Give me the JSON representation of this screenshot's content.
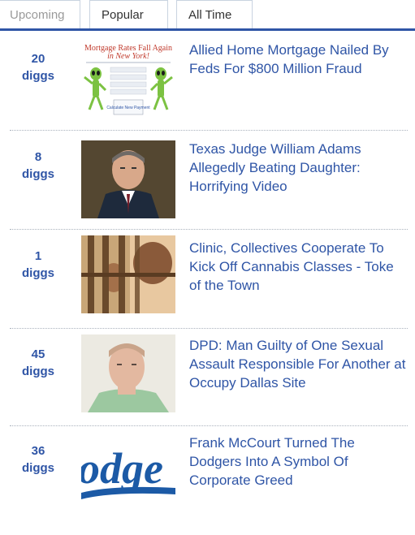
{
  "tabs": [
    {
      "label": "Upcoming"
    },
    {
      "label": "Popular"
    },
    {
      "label": "All Time"
    }
  ],
  "colors": {
    "link": "#2f55a6",
    "tab_rule": "#2f55a6",
    "inactive_tab_text": "#9a9a9a"
  },
  "stories": [
    {
      "count": "20",
      "unit": "diggs",
      "title": "Allied Home Mortgage Nailed By Feds For $800 Million Fraud",
      "thumb_text_1": "Mortgage Rates Fall Again",
      "thumb_text_2": "in New York!",
      "thumb_text_3": "Calculate New Payment",
      "thumb_icon": "alien-dancing-ad-icon"
    },
    {
      "count": "8",
      "unit": "diggs",
      "title": "Texas Judge William Adams Allegedly Beating Daughter: Horrifying Video",
      "thumb_icon": "man-portrait-icon"
    },
    {
      "count": "1",
      "unit": "diggs",
      "title": "Clinic, Collectives Cooperate To Kick Off Cannabis Classes - Toke of the Town",
      "thumb_icon": "jail-bars-icon"
    },
    {
      "count": "45",
      "unit": "diggs",
      "title": "DPD: Man Guilty of One Sexual Assault Responsible For Another at Occupy Dallas Site",
      "thumb_icon": "mugshot-icon"
    },
    {
      "count": "36",
      "unit": "diggs",
      "title": "Frank McCourt Turned The Dodgers Into A Symbol Of Corporate Greed",
      "thumb_text_1": "odge",
      "thumb_icon": "dodgers-logo-icon"
    }
  ]
}
